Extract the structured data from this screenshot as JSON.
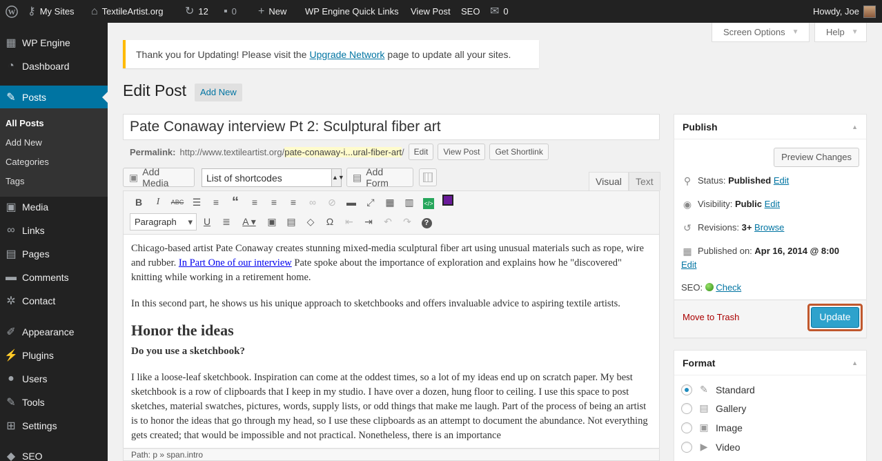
{
  "adminbar": {
    "my_sites": "My Sites",
    "site_name": "TextileArtist.org",
    "updates_count": "12",
    "comments_count": "0",
    "new_label": "New",
    "quick_links": "WP Engine Quick Links",
    "view_post": "View Post",
    "seo": "SEO",
    "messages_count": "0",
    "howdy": "Howdy, Joe"
  },
  "sidebar": {
    "items": [
      {
        "label": "WP Engine",
        "icon": "wpengine-icon"
      },
      {
        "label": "Dashboard",
        "icon": "dashboard-icon"
      },
      {
        "label": "Posts",
        "icon": "pin-icon"
      },
      {
        "label": "Media",
        "icon": "media-icon"
      },
      {
        "label": "Links",
        "icon": "link-icon"
      },
      {
        "label": "Pages",
        "icon": "pages-icon"
      },
      {
        "label": "Comments",
        "icon": "comment-icon"
      },
      {
        "label": "Contact",
        "icon": "gear-icon"
      },
      {
        "label": "Appearance",
        "icon": "brush-icon"
      },
      {
        "label": "Plugins",
        "icon": "plugin-icon"
      },
      {
        "label": "Users",
        "icon": "user-icon"
      },
      {
        "label": "Tools",
        "icon": "wrench-icon"
      },
      {
        "label": "Settings",
        "icon": "settings-icon"
      },
      {
        "label": "SEO",
        "icon": "seo-icon"
      }
    ],
    "posts_submenu": [
      "All Posts",
      "Add New",
      "Categories",
      "Tags"
    ]
  },
  "screen_options": "Screen Options",
  "help": "Help",
  "notice": {
    "text_before": "Thank you for Updating! Please visit the",
    "link": "Upgrade Network",
    "text_after": "page to update all your sites."
  },
  "page": {
    "title": "Edit Post",
    "add_new": "Add New"
  },
  "post": {
    "title": "Pate Conaway interview Pt 2: Sculptural fiber art",
    "permalink_label": "Permalink:",
    "permalink_base": "http://www.textileartist.org/",
    "permalink_slug": "pate-conaway-i...ural-fiber-art",
    "permalink_end": "/",
    "edit_btn": "Edit",
    "view_post_btn": "View Post",
    "shortlink_btn": "Get Shortlink"
  },
  "editor": {
    "add_media": "Add Media",
    "shortcodes": "List of shortcodes",
    "add_form": "Add Form",
    "tab_visual": "Visual",
    "tab_text": "Text",
    "format": "Paragraph",
    "path": "Path: p » span.intro"
  },
  "content": {
    "p1_before": "Chicago-based artist Pate Conaway creates stunning mixed-media sculptural fiber art using unusual materials such as rope, wire and rubber.",
    "p1_link": "In Part One of our interview",
    "p1_after": "Pate spoke about the importance of exploration and explains how he \"discovered\" knitting while working in a retirement home.",
    "p2": "In this second part, he shows us his unique approach to sketchbooks and offers invaluable advice to aspiring textile artists.",
    "h2": "Honor the ideas",
    "h4": "Do you use a sketchbook?",
    "p3": "I like a loose-leaf sketchbook. Inspiration can come at the oddest times, so a lot of my ideas end up on scratch paper. My best sketchbook is a row of clipboards that I keep in my studio. I have over a dozen, hung floor to ceiling. I use this space to post sketches, material swatches, pictures, words, supply lists, or odd things that make me laugh. Part of the process of being an artist is to honor the ideas that go through my head, so I use these clipboards as an attempt to document the abundance. Not everything gets created; that would be impossible and not practical. Nonetheless, there is an importance"
  },
  "publish": {
    "title": "Publish",
    "preview": "Preview Changes",
    "status_label": "Status:",
    "status_value": "Published",
    "visibility_label": "Visibility:",
    "visibility_value": "Public",
    "revisions_label": "Revisions:",
    "revisions_value": "3+",
    "browse": "Browse",
    "published_label": "Published on:",
    "published_value": "Apr 16, 2014 @ 8:00",
    "edit": "Edit",
    "seo_label": "SEO:",
    "seo_check": "Check",
    "trash": "Move to Trash",
    "update": "Update"
  },
  "format_box": {
    "title": "Format",
    "options": [
      "Standard",
      "Gallery",
      "Image",
      "Video"
    ],
    "selected": "Standard"
  }
}
